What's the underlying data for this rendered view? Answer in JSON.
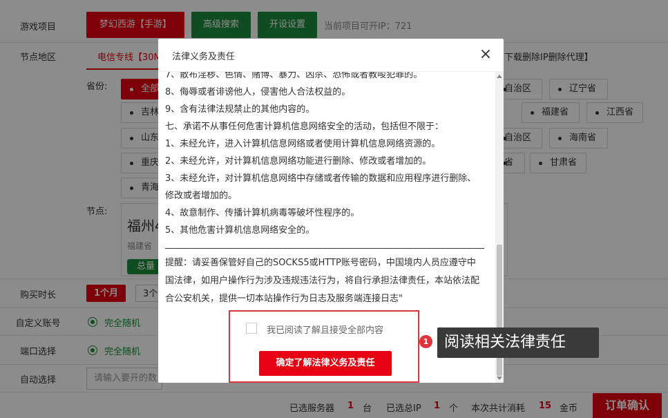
{
  "form": {
    "game_label": "游戏项目",
    "game_selected": "梦幻西游【手游】",
    "advanced_search": "高级搜索",
    "open_settings": "开设设置",
    "available_ip": "当前项目可开IP：721",
    "region_label": "节点地区",
    "region_tab": "电信专线【30M",
    "region_right": "下载删除IP删除代理】",
    "province_label": "省份:",
    "provinces_left": [
      "全部",
      "吉林",
      "山东",
      "重庆",
      "青海"
    ],
    "provinces_right": [
      "自治区",
      "辽宁省",
      "福建省",
      "江西省",
      "自治区",
      "海南省",
      "省",
      "甘肃省"
    ],
    "node_label": "节点:",
    "node_city": "福州4",
    "node_province": "福建省",
    "node_total": "总量",
    "duration_label": "购买时长",
    "duration_selected": "1个月",
    "duration_other": "3个",
    "custom_account_label": "自定义账号",
    "custom_account_value": "完全随机",
    "port_label": "端口选择",
    "port_value": "完全随机",
    "auto_label": "自动选择",
    "auto_placeholder": "请输入要开的数"
  },
  "modal": {
    "title": "法律义务及责任",
    "close": "×",
    "terms": [
      "7、散布淫秽、色情、赌博、暴力、凶杀、恐怖或者教唆犯罪的。",
      "8、侮辱或者诽谤他人，侵害他人合法权益的。",
      "9、含有法律法规禁止的其他内容的。",
      "七、承诺不从事任何危害计算机信息网络安全的活动，包括但不限于：",
      "1、未经允许，进入计算机信息网络或者使用计算机信息网络资源的。",
      "2、未经允许，对计算机信息网络功能进行删除、修改或者增加的。",
      "3、未经允许，对计算机信息网络中存储或者传输的数据和应用程序进行删除、修改或者增加的。",
      "4、故意制作、传播计算机病毒等破坏性程序的。",
      "5、其他危害计算机信息网络安全的。"
    ],
    "reminder": "提醒：请妥善保管好自己的SOCKS5或HTTP账号密码，中国境内人员应遵守中国法律，如用户操作行为涉及违规违法行为，将自行承担法律责任，本站依法配合公安机关，提供一切本站操作行为日志及服务端连接日志\"",
    "agree_label": "我已阅读了解且接受全部内容",
    "confirm_button": "确定了解法律义务及责任"
  },
  "tutorial": {
    "step": "1",
    "tip": "阅读相关法律责任"
  },
  "footer": {
    "servers_label": "已选服务器",
    "servers_count": "1",
    "servers_unit": "台",
    "ip_label": "已选总IP",
    "ip_count": "1",
    "ip_unit": "个",
    "cost_label": "本次共计消耗",
    "cost_value": "15",
    "cost_unit": "金币",
    "order_button": "订单确认"
  }
}
